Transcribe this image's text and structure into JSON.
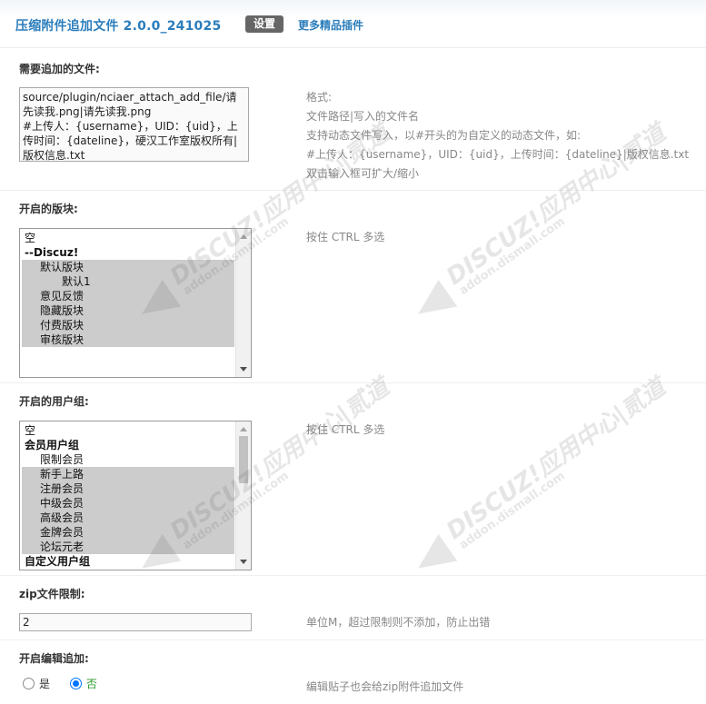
{
  "header": {
    "title": "压缩附件追加文件 2.0.0_241025",
    "settings_label": "设置",
    "more_plugins_label": "更多精品插件"
  },
  "files": {
    "label": "需要追加的文件:",
    "value": "source/plugin/nciaer_attach_add_file/请先读我.png|请先读我.png\n#上传人：{username}，UID：{uid}，上传时间：{dateline}，硬汉工作室版权所有|版权信息.txt",
    "hint": [
      "格式:",
      "文件路径|写入的文件名",
      "支持动态文件写入，以#开头的为自定义的动态文件，如:",
      "#上传人：{username}，UID：{uid}，上传时间：{dateline}|版权信息.txt",
      "双击输入框可扩大/缩小"
    ]
  },
  "forums": {
    "label": "开启的版块:",
    "hint": "按住 CTRL 多选",
    "options": [
      {
        "text": "空",
        "level": 0,
        "group": false,
        "selected": false
      },
      {
        "text": "--Discuz!",
        "level": 0,
        "group": true,
        "selected": false
      },
      {
        "text": "默认版块",
        "level": 1,
        "group": false,
        "selected": true
      },
      {
        "text": "默认1",
        "level": 2,
        "group": false,
        "selected": true
      },
      {
        "text": "意见反馈",
        "level": 1,
        "group": false,
        "selected": true
      },
      {
        "text": "隐藏版块",
        "level": 1,
        "group": false,
        "selected": true
      },
      {
        "text": "付费版块",
        "level": 1,
        "group": false,
        "selected": true
      },
      {
        "text": "审核版块",
        "level": 1,
        "group": false,
        "selected": true
      }
    ]
  },
  "usergroups": {
    "label": "开启的用户组:",
    "hint": "按住 CTRL 多选",
    "options": [
      {
        "text": "空",
        "level": 0,
        "group": false,
        "selected": false
      },
      {
        "text": "会员用户组",
        "level": 0,
        "group": true,
        "selected": false
      },
      {
        "text": "限制会员",
        "level": 1,
        "group": false,
        "selected": false
      },
      {
        "text": "新手上路",
        "level": 1,
        "group": false,
        "selected": true
      },
      {
        "text": "注册会员",
        "level": 1,
        "group": false,
        "selected": true
      },
      {
        "text": "中级会员",
        "level": 1,
        "group": false,
        "selected": true
      },
      {
        "text": "高级会员",
        "level": 1,
        "group": false,
        "selected": true
      },
      {
        "text": "金牌会员",
        "level": 1,
        "group": false,
        "selected": true
      },
      {
        "text": "论坛元老",
        "level": 1,
        "group": false,
        "selected": true
      },
      {
        "text": "自定义用户组",
        "level": 0,
        "group": true,
        "selected": false
      }
    ]
  },
  "zip_limit": {
    "label": "zip文件限制:",
    "value": "2",
    "hint": "单位M，超过限制则不添加，防止出错"
  },
  "edit_append": {
    "label": "开启编辑追加:",
    "yes_label": "是",
    "no_label": "否",
    "selected": "no",
    "hint": "编辑贴子也会给zip附件追加文件"
  },
  "watermark": {
    "main": "DISCUZ!应用中心|贰道",
    "sub": "addon.dismall.com"
  },
  "colors": {
    "accent": "#2b7dbc",
    "selected_option": "#cccccc",
    "radio_on": "#0075ff"
  }
}
